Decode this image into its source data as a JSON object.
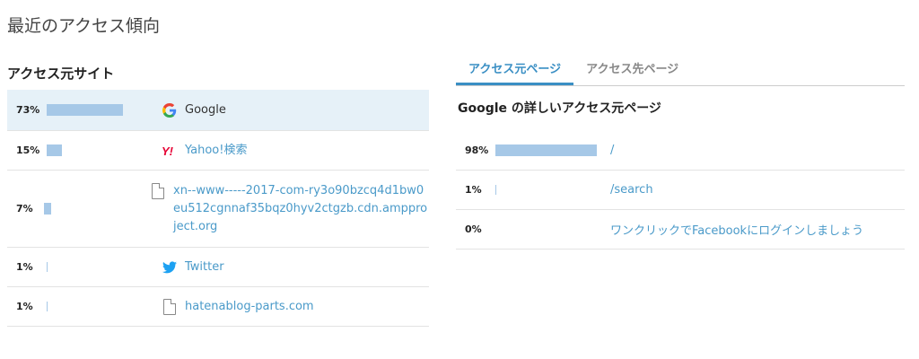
{
  "page_title": "最近のアクセス傾向",
  "left": {
    "title": "アクセス元サイト",
    "rows": [
      {
        "percent_label": "73%",
        "value": 73,
        "site": "Google",
        "icon": "google-icon",
        "link": false,
        "selected": true
      },
      {
        "percent_label": "15%",
        "value": 15,
        "site": "Yahoo!検索",
        "icon": "yahoo-icon",
        "link": true,
        "selected": false
      },
      {
        "percent_label": "7%",
        "value": 7,
        "site": "xn--www-----2017-com-ry3o90bzcq4d1bw0eu512cgnnaf35bqz0hyv2ctgzb.cdn.ampproject.org",
        "icon": "document-icon",
        "link": true,
        "selected": false
      },
      {
        "percent_label": "1%",
        "value": 1,
        "site": "Twitter",
        "icon": "twitter-icon",
        "link": true,
        "selected": false
      },
      {
        "percent_label": "1%",
        "value": 1,
        "site": "hatenablog-parts.com",
        "icon": "document-icon",
        "link": true,
        "selected": false
      }
    ]
  },
  "right": {
    "tabs": [
      {
        "label": "アクセス元ページ",
        "active": true
      },
      {
        "label": "アクセス先ページ",
        "active": false
      }
    ],
    "detail_title": "Google の詳しいアクセス元ページ",
    "rows": [
      {
        "percent_label": "98%",
        "value": 98,
        "page": "/"
      },
      {
        "percent_label": "1%",
        "value": 1,
        "page": "/search"
      },
      {
        "percent_label": "0%",
        "value": 0,
        "page": "ワンクリックでFacebookにログインしましょう"
      }
    ]
  },
  "colors": {
    "bar": "#a6c8e7",
    "link": "#4a9ac9",
    "selected_row": "#e6f1f8",
    "tab_active": "#3a8fc4"
  }
}
